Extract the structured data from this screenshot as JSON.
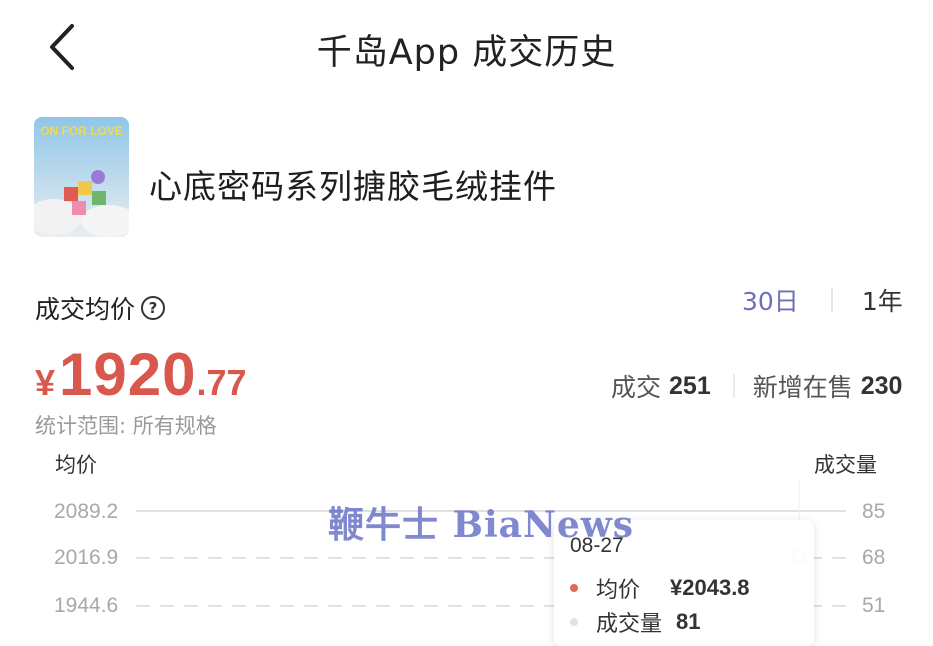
{
  "header": {
    "title": "千岛App 成交历史"
  },
  "product": {
    "name": "心底密码系列搪胶毛绒挂件",
    "thumbnail_text": "ON FOR LOVE"
  },
  "stats": {
    "avg_label": "成交均价",
    "price_currency": "¥",
    "price_integer": "1920",
    "price_decimal": ".77",
    "scope": "统计范围: 所有规格",
    "tabs": [
      {
        "label": "30日",
        "active": true
      },
      {
        "label": "1年",
        "active": false
      }
    ],
    "trades_label": "成交",
    "trades_value": "251",
    "new_listings_label": "新增在售",
    "new_listings_value": "230"
  },
  "chart_data": {
    "type": "line",
    "y_left_label": "均价",
    "y_right_label": "成交量",
    "y_left_ticks": [
      "2089.2",
      "2016.9",
      "1944.6"
    ],
    "y_right_ticks": [
      "85",
      "68",
      "51"
    ],
    "y_left_range": [
      1944.6,
      2089.2
    ],
    "y_right_range": [
      51,
      85
    ],
    "grid": true,
    "tooltip": {
      "date": "08-27",
      "avg_label": "均价",
      "avg_value": "¥2043.8",
      "volume_label": "成交量",
      "volume_value": "81",
      "avg_color": "#e0675e",
      "volume_color": "#dde3ee"
    }
  },
  "watermark": {
    "text": "鞭牛士 BiaNews"
  },
  "colors": {
    "price": "#d9574c",
    "accent": "#6f6fb8"
  },
  "icons": {
    "back": "chevron-left-icon",
    "help": "question-circle-icon"
  }
}
